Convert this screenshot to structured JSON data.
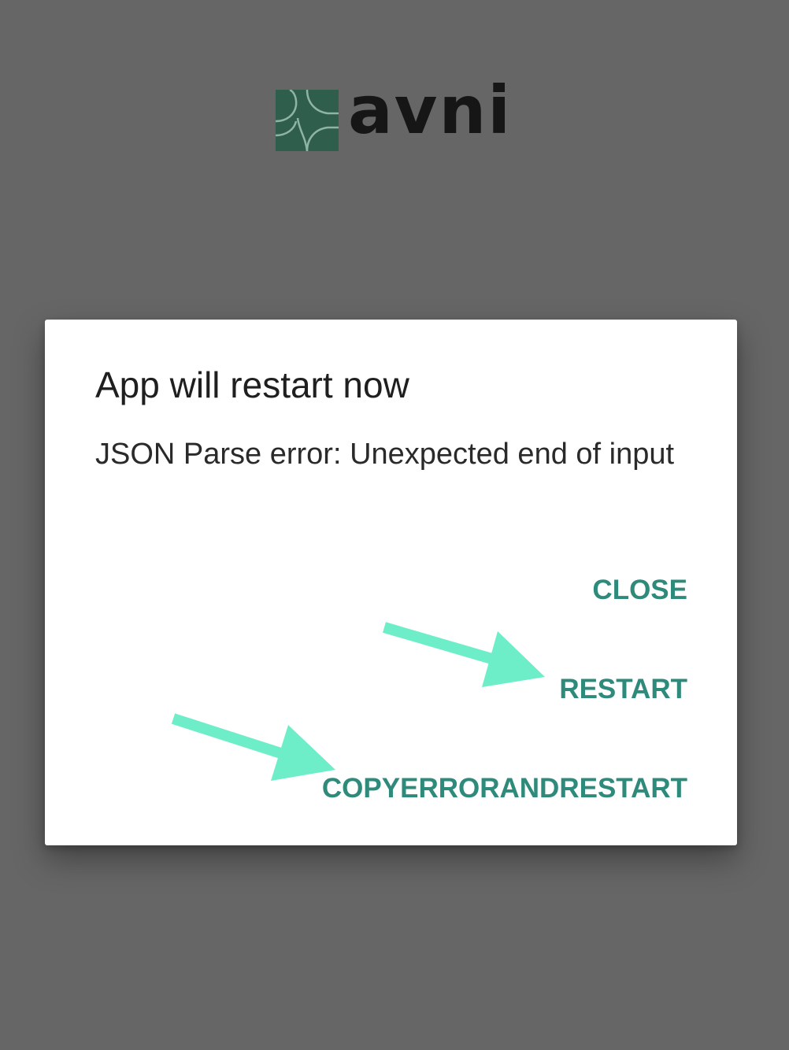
{
  "app": {
    "logo_text": "avni",
    "logo_color": "#2f5e4c"
  },
  "dialog": {
    "title": "App will restart now",
    "message": "JSON Parse error: Unexpected end of input",
    "buttons": {
      "close": "CLOSE",
      "restart": "RESTART",
      "copy_error_and_restart": "COPYERRORANDRESTART"
    },
    "button_color": "#2e8a7a"
  },
  "annotations": {
    "arrow_color": "#6eeec8",
    "arrows": [
      "arrow-to-restart",
      "arrow-to-copyerrorandrestart"
    ]
  }
}
